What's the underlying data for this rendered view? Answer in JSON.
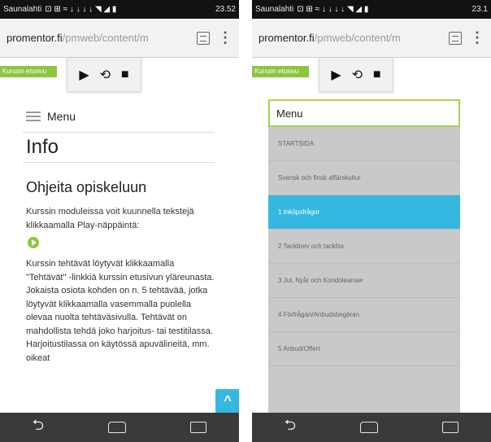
{
  "left_phone": {
    "status": {
      "carrier": "Saunalahti",
      "time": "23.52"
    },
    "browser": {
      "url_host": "promentor.fi",
      "url_path": "/pmweb/content/m"
    },
    "site": {
      "link_label": "Kurssin etusivu",
      "player": {
        "play": "▶",
        "replay": "⟲",
        "stop": "■"
      },
      "menu_label": "Menu",
      "page_title": "Info",
      "section_title": "Ohjeita opiskeluun",
      "intro": "Kurssin moduleissa voit kuunnella tekstejä klikkaamalla Play-näppäintä:",
      "body": "Kurssin tehtävät löytyvät klikkaamalla \"Tehtävät\" -linkkiä kurssin etusivun yläreunasta. Jokaista osiota kohden on n. 5 tehtävää, jotka löytyvät klikkaamalla vasemmalla puolella olevaa nuolta tehtäväsivulla. Tehtävät on mahdollista tehdä joko harjoitus- tai testitilassa. Harjoitustilassa on käytössä apuvälineitä, mm. oikeat"
    }
  },
  "right_phone": {
    "status": {
      "carrier": "Saunalahti",
      "time": "23.1"
    },
    "browser": {
      "url_host": "promentor.fi",
      "url_path": "/pmweb/content/m"
    },
    "site": {
      "link_label": "Kurssin etusivu",
      "player": {
        "play": "▶",
        "replay": "⟲",
        "stop": "■"
      },
      "menu_label": "Menu",
      "menu_items": [
        "STARTSIDA",
        "Svensk och finsk affärskultur",
        "1 Inköpsfrågor",
        "2 Tackbrev och tackfax",
        "3 Jul, Nyår och Kondoleanser",
        "4 Förfrågan/Anbudsbegäran",
        "5 Anbud/Offert"
      ],
      "active_index": 2
    }
  },
  "icons": {
    "signal_icons": "⊡ ⊞ ≈ ↓ ↓ ↓ ↓ ◥ ◢ ▮",
    "back": "⮌",
    "up_arrow": "^"
  },
  "colors": {
    "accent_green": "#8cc63f",
    "accent_blue": "#35b8e0"
  }
}
